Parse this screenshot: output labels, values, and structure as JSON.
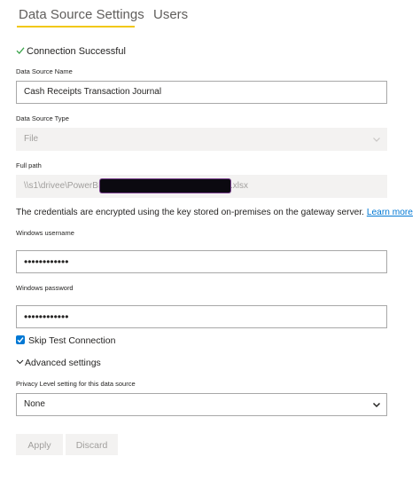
{
  "tabs": [
    {
      "label": "Data Source Settings",
      "active": true
    },
    {
      "label": "Users",
      "active": false
    }
  ],
  "colors": {
    "accent": "#f2c811",
    "link": "#0078d4",
    "success": "#3aa34a"
  },
  "status": {
    "icon": "check-icon",
    "text": "Connection Successful"
  },
  "datasource_name": {
    "label": "Data Source Name",
    "value": "Cash Receipts Transaction Journal"
  },
  "datasource_type": {
    "label": "Data Source Type",
    "value": "File"
  },
  "full_path": {
    "label": "Full path",
    "value_prefix": "\\\\s1\\drivee\\PowerBI\\",
    "value_suffix": ".xlsx"
  },
  "info": {
    "text": "The credentials are encrypted using the key stored on-premises on the gateway server.",
    "link": "Learn more"
  },
  "windows_username": {
    "label": "Windows username",
    "value": "••••••••••••"
  },
  "windows_password": {
    "label": "Windows password",
    "value": "••••••••••••"
  },
  "skip_test": {
    "label": "Skip Test Connection",
    "checked": true
  },
  "advanced": {
    "label": "Advanced settings"
  },
  "privacy": {
    "label": "Privacy Level setting for this data source",
    "value": "None"
  },
  "buttons": {
    "apply": "Apply",
    "discard": "Discard"
  }
}
